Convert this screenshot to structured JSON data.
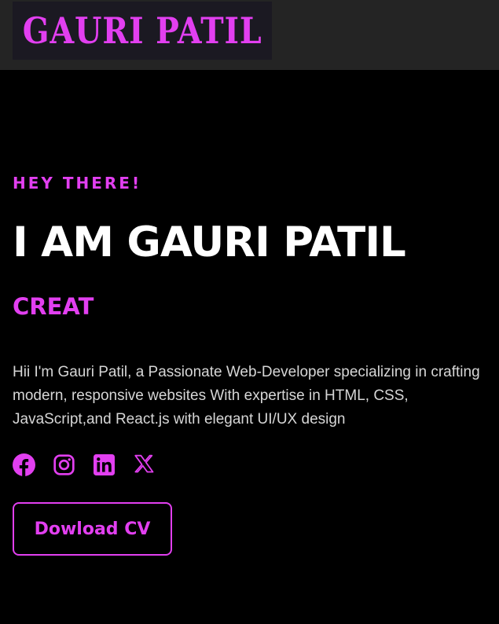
{
  "header": {
    "logo_text": "GAURI PATIL"
  },
  "hero": {
    "greeting": "HEY THERE!",
    "title": "I AM GAURI PATIL",
    "typing_text": "CREAT",
    "bio": "Hii I'm Gauri Patil, a Passionate Web-Developer specializing in crafting modern, responsive websites With expertise in HTML, CSS, JavaScript,and React.js with elegant UI/UX design",
    "download_button": "Dowload CV"
  },
  "socials": [
    {
      "icon": "facebook-icon"
    },
    {
      "icon": "instagram-icon"
    },
    {
      "icon": "linkedin-icon"
    },
    {
      "icon": "x-twitter-icon"
    }
  ],
  "colors": {
    "accent": "#e23ff0",
    "background": "#000000",
    "header_bg": "#242424",
    "text": "#ffffff",
    "body_text": "#d6d6d6"
  }
}
